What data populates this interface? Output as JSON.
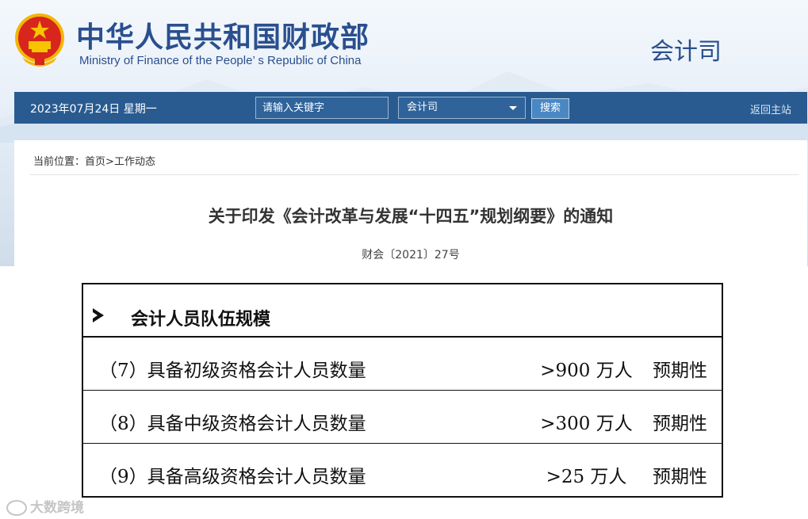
{
  "header": {
    "site_title_cn": "中华人民共和国财政部",
    "site_title_en": "Ministry of Finance of the People’ s Republic of China",
    "department": "会计司"
  },
  "navbar": {
    "date": "2023年07月24日  星期一",
    "search_placeholder": "请输入关键字",
    "scope_selected": "会计司",
    "search_button": "搜索",
    "home_link": "返回主站"
  },
  "breadcrumb": {
    "prefix": "当前位置：",
    "home": "首页",
    "separator": ">",
    "current": "工作动态"
  },
  "article": {
    "title": "关于印发《会计改革与发展“十四五”规划纲要》的通知",
    "doc_number": "财会〔2021〕27号"
  },
  "table": {
    "section_title": "会计人员队伍规模",
    "rows": [
      {
        "label": "（7）具备初级资格会计人员数量",
        "value": ">900 万人",
        "type": "预期性"
      },
      {
        "label": "（8）具备中级资格会计人员数量",
        "value": ">300 万人",
        "type": "预期性"
      },
      {
        "label": "（9）具备高级资格会计人员数量",
        "value": ">25 万人",
        "type": "预期性"
      }
    ]
  },
  "watermark": "大数跨境",
  "colors": {
    "brand_blue": "#2a4f8f",
    "navbar": "#295b91",
    "search_button": "#4a88c4"
  },
  "icons": {
    "emblem": "national-emblem-icon",
    "dropdown": "chevron-down-icon",
    "bullet": "arrow-bullet-icon"
  }
}
